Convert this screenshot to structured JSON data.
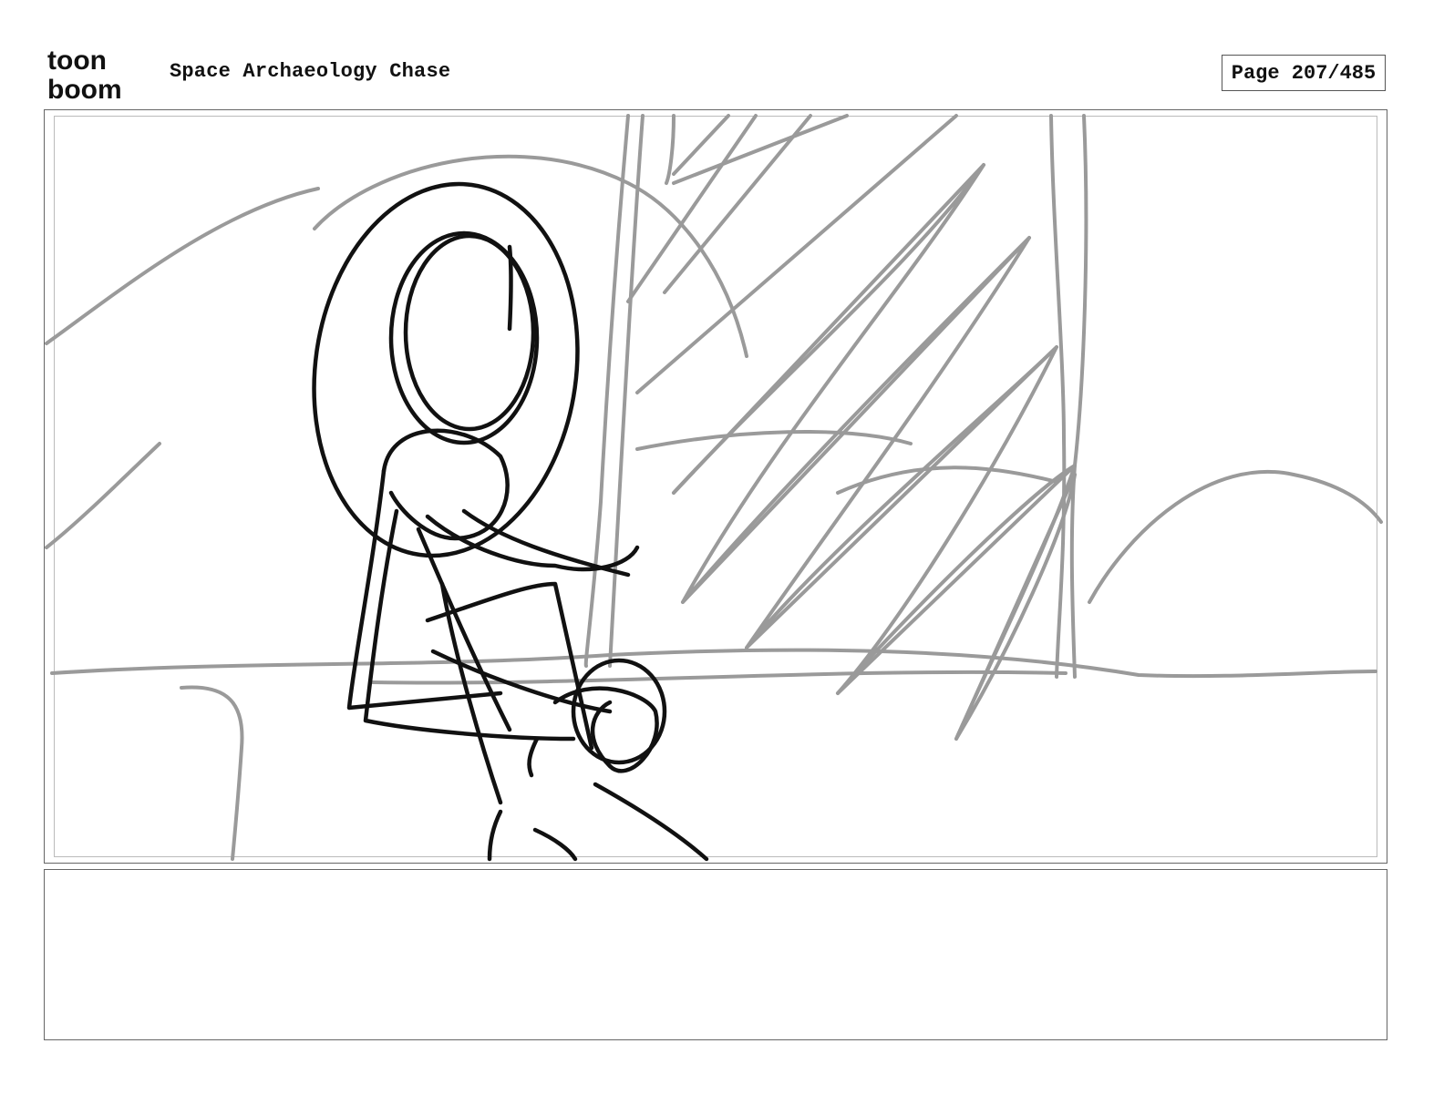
{
  "header": {
    "logo_line1": "toon",
    "logo_line2": "boom",
    "project_title": "Space Archaeology Chase",
    "page_indicator": "Page 207/485"
  },
  "panel": {
    "sketch_description_icon": "storyboard-sketch"
  },
  "notes": {
    "text": ""
  },
  "colors": {
    "ink_dark": "#111111",
    "ink_light": "#9a9a9a",
    "frame_border": "#666666"
  }
}
